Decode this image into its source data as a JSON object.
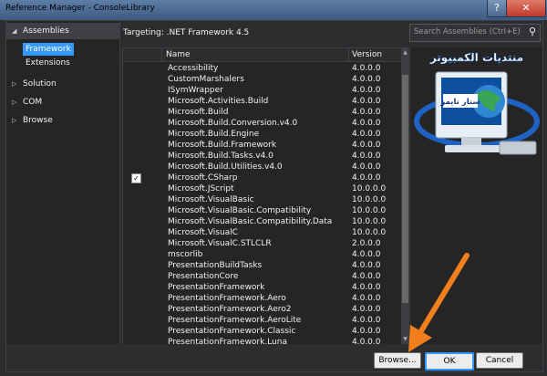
{
  "window": {
    "title": "Reference Manager - ConsoleLibrary",
    "help": "?",
    "close": "✕"
  },
  "sidebar": {
    "items": [
      {
        "label": "Assemblies",
        "expanded": true,
        "selected": true
      },
      {
        "label": "Solution"
      },
      {
        "label": "COM"
      },
      {
        "label": "Browse"
      }
    ],
    "subitems": [
      {
        "label": "Framework",
        "selected": true
      },
      {
        "label": "Extensions"
      }
    ]
  },
  "header": {
    "targeting": "Targeting: .NET Framework 4.5"
  },
  "search": {
    "placeholder": "Search Assemblies (Ctrl+E)"
  },
  "table": {
    "columns": [
      "Name",
      "Version"
    ],
    "rows": [
      {
        "name": "Accessibility",
        "version": "4.0.0.0"
      },
      {
        "name": "CustomMarshalers",
        "version": "4.0.0.0"
      },
      {
        "name": "ISymWrapper",
        "version": "4.0.0.0"
      },
      {
        "name": "Microsoft.Activities.Build",
        "version": "4.0.0.0"
      },
      {
        "name": "Microsoft.Build",
        "version": "4.0.0.0"
      },
      {
        "name": "Microsoft.Build.Conversion.v4.0",
        "version": "4.0.0.0"
      },
      {
        "name": "Microsoft.Build.Engine",
        "version": "4.0.0.0"
      },
      {
        "name": "Microsoft.Build.Framework",
        "version": "4.0.0.0"
      },
      {
        "name": "Microsoft.Build.Tasks.v4.0",
        "version": "4.0.0.0"
      },
      {
        "name": "Microsoft.Build.Utilities.v4.0",
        "version": "4.0.0.0"
      },
      {
        "name": "Microsoft.CSharp",
        "version": "4.0.0.0",
        "checked": true
      },
      {
        "name": "Microsoft.JScript",
        "version": "10.0.0.0"
      },
      {
        "name": "Microsoft.VisualBasic",
        "version": "10.0.0.0"
      },
      {
        "name": "Microsoft.VisualBasic.Compatibility",
        "version": "10.0.0.0"
      },
      {
        "name": "Microsoft.VisualBasic.Compatibility.Data",
        "version": "10.0.0.0"
      },
      {
        "name": "Microsoft.VisualC",
        "version": "10.0.0.0"
      },
      {
        "name": "Microsoft.VisualC.STLCLR",
        "version": "2.0.0.0"
      },
      {
        "name": "mscorlib",
        "version": "4.0.0.0"
      },
      {
        "name": "PresentationBuildTasks",
        "version": "4.0.0.0"
      },
      {
        "name": "PresentationCore",
        "version": "4.0.0.0"
      },
      {
        "name": "PresentationFramework",
        "version": "4.0.0.0"
      },
      {
        "name": "PresentationFramework.Aero",
        "version": "4.0.0.0"
      },
      {
        "name": "PresentationFramework.Aero2",
        "version": "4.0.0.0"
      },
      {
        "name": "PresentationFramework.AeroLite",
        "version": "4.0.0.0"
      },
      {
        "name": "PresentationFramework.Classic",
        "version": "4.0.0.0"
      },
      {
        "name": "PresentationFramework.Luna",
        "version": "4.0.0.0"
      }
    ]
  },
  "buttons": {
    "browse": "Browse...",
    "ok": "OK",
    "cancel": "Cancel"
  },
  "logo": {
    "top": "منتديات الكمبيوتر",
    "banner": "ستار تايمز"
  },
  "colors": {
    "accent": "#3399ff",
    "annotation": "#f07f1c",
    "background": "#2d2d30"
  }
}
